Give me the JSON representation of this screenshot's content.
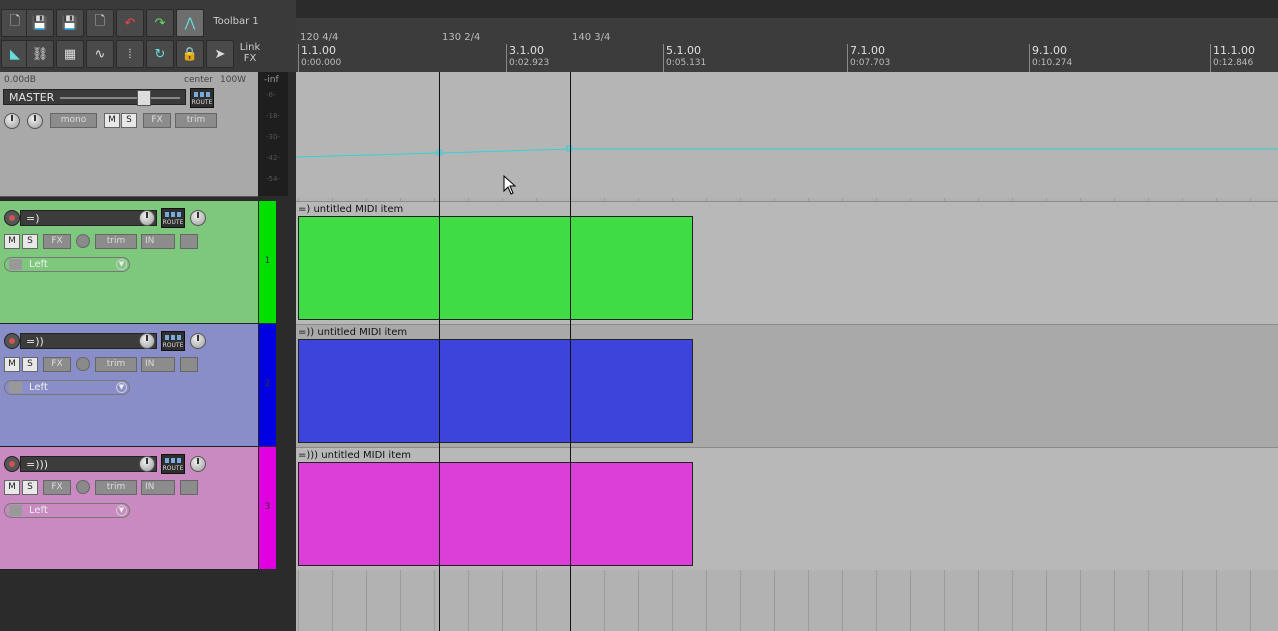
{
  "toolbar": {
    "label": "Toolbar 1",
    "link_fx": "Link FX",
    "icons": [
      "new-project-icon",
      "save-icon",
      "save-as-icon",
      "project-settings-icon",
      "undo-icon",
      "redo-icon",
      "snap-icon",
      "metronome-icon",
      "ripple-icon",
      "grid-icon",
      "envelope-icon",
      "loop-icon",
      "lock-icon",
      "select-tool-icon"
    ]
  },
  "master": {
    "volume": "0.00dB",
    "pan": "center",
    "width": "100W",
    "name": "MASTER",
    "mono": "mono",
    "mute": "M",
    "solo": "S",
    "fx": "FX",
    "trim": "trim",
    "route": "ROUTE",
    "meter_inf": "-inf",
    "meter_marks": [
      "-6-",
      "-18-",
      "-30-",
      "-42-",
      "-54-"
    ]
  },
  "tracks": [
    {
      "name": "=)",
      "number": "1",
      "mute": "M",
      "solo": "S",
      "fx": "FX",
      "trim": "trim",
      "in": "IN",
      "input": "Left",
      "route": "ROUTE",
      "color": "#7ec87e",
      "num_color": "#00e000",
      "item_title": "=) untitled MIDI item",
      "item_color": "#3fdc45"
    },
    {
      "name": "=))",
      "number": "2",
      "mute": "M",
      "solo": "S",
      "fx": "FX",
      "trim": "trim",
      "in": "IN",
      "input": "Left",
      "route": "ROUTE",
      "color": "#8a8ec8",
      "num_color": "#0000e0",
      "item_title": "=)) untitled MIDI item",
      "item_color": "#3c44dc"
    },
    {
      "name": "=)))",
      "number": "3",
      "mute": "M",
      "solo": "S",
      "fx": "FX",
      "trim": "trim",
      "in": "IN",
      "input": "Left",
      "route": "ROUTE",
      "color": "#c88ac0",
      "num_color": "#e000e0",
      "item_title": "=))) untitled MIDI item",
      "item_color": "#dc3fd8"
    }
  ],
  "ruler": {
    "tempo_markers": [
      "120 4/4",
      "130 2/4",
      "140 3/4"
    ],
    "bars": [
      {
        "bar": "1.1.00",
        "time": "0:00.000"
      },
      {
        "bar": "3.1.00",
        "time": "0:02.923"
      },
      {
        "bar": "5.1.00",
        "time": "0:05.131"
      },
      {
        "bar": "7.1.00",
        "time": "0:07.703"
      },
      {
        "bar": "9.1.00",
        "time": "0:10.274"
      },
      {
        "bar": "11.1.00",
        "time": "0:12.846"
      }
    ]
  },
  "colors": {
    "envelope": "#35d0d8"
  }
}
